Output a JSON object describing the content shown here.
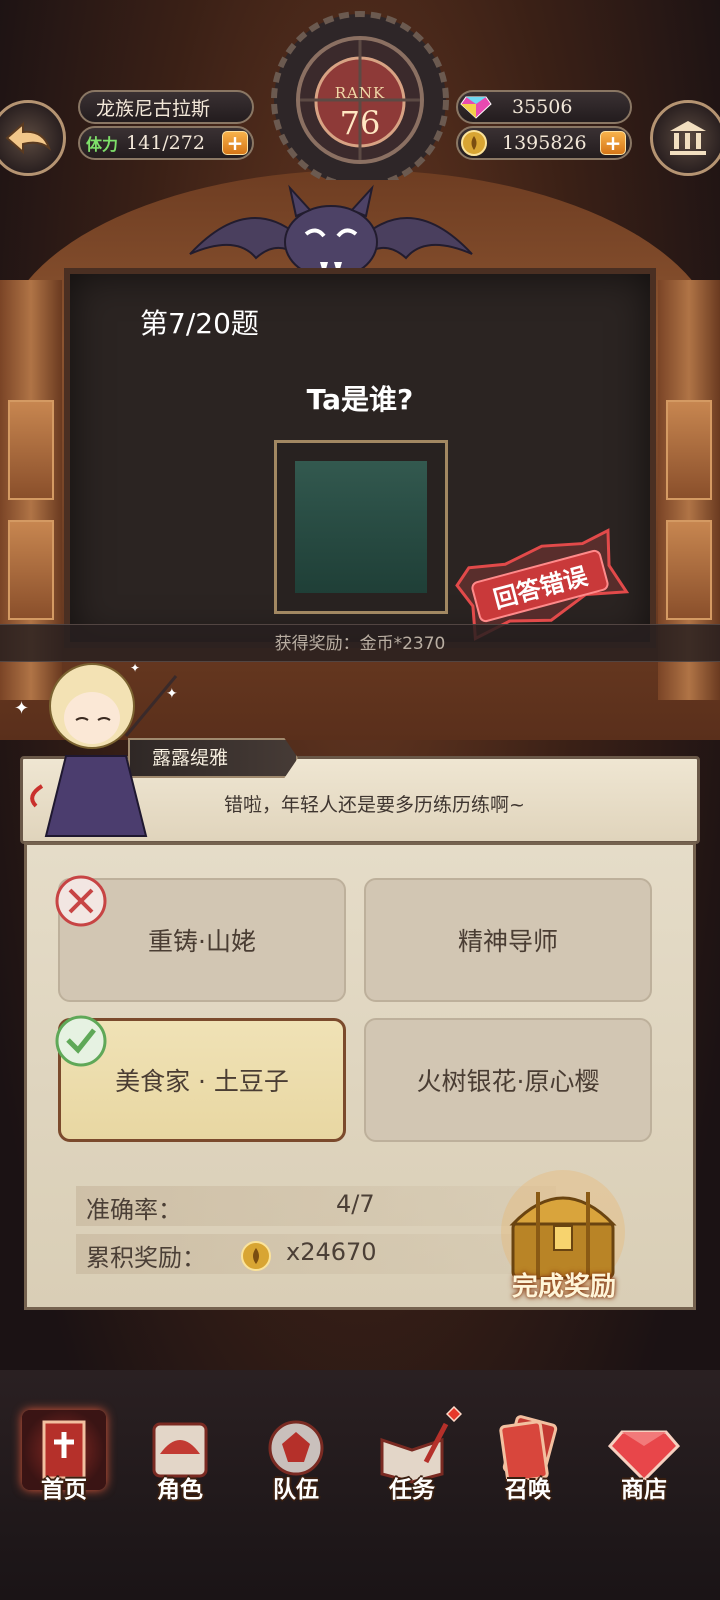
{
  "hud": {
    "player_name": "龙族尼古拉斯",
    "stamina_label": "体力",
    "stamina_value": "141/272",
    "rank_label": "RANK",
    "rank_value": "76",
    "gems": "35506",
    "gold": "1395826",
    "plus": "+"
  },
  "quiz": {
    "question_number": "第7/20题",
    "question_text": "Ta是谁?",
    "result_stamp": "回答错误",
    "reward_text": "获得奖励：金币*2370"
  },
  "dialog": {
    "speaker": "露露缇雅",
    "text": "错啦，年轻人还是要多历练历练啊~"
  },
  "answers": [
    {
      "label": "重铸·山姥",
      "state": "wrong"
    },
    {
      "label": "精神导师",
      "state": "none"
    },
    {
      "label": "美食家 · 土豆子",
      "state": "correct"
    },
    {
      "label": "火树银花·原心樱",
      "state": "none"
    }
  ],
  "stats": {
    "accuracy_label": "准确率：",
    "accuracy_value": "4/7",
    "reward_label": "累积奖励：",
    "reward_value": "x24670",
    "chest_label": "完成奖励"
  },
  "bottom_nav": [
    {
      "label": "首页",
      "icon": "home-icon",
      "active": true
    },
    {
      "label": "角色",
      "icon": "character-icon",
      "active": false
    },
    {
      "label": "队伍",
      "icon": "team-icon",
      "active": false
    },
    {
      "label": "任务",
      "icon": "quest-icon",
      "active": false,
      "badge": true
    },
    {
      "label": "召唤",
      "icon": "summon-icon",
      "active": false
    },
    {
      "label": "商店",
      "icon": "shop-icon",
      "active": false
    }
  ],
  "colors": {
    "accent_orange": "#e58a25",
    "stamp_red": "#e24a4a",
    "correct_green": "#5fa858",
    "wrong_red": "#c74444"
  }
}
